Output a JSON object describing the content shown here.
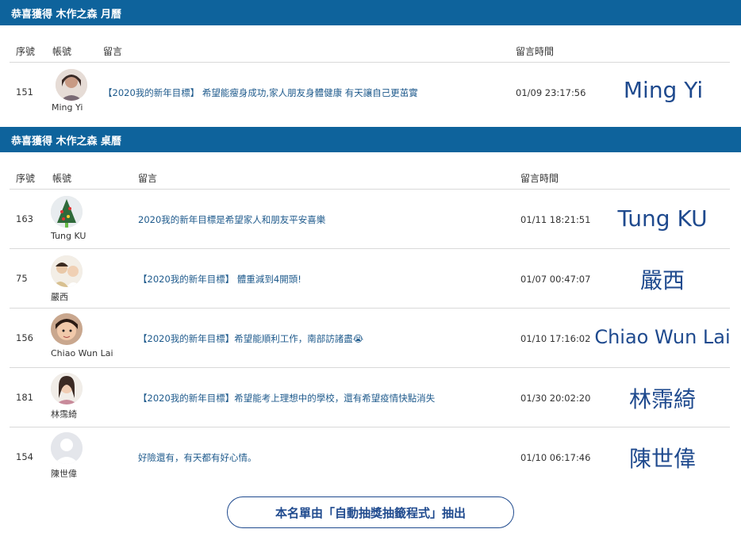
{
  "monthly": {
    "title": "恭喜獲得 木作之森 月曆",
    "headers": {
      "seq": "序號",
      "account": "帳號",
      "message": "留言",
      "time": "留言時間"
    },
    "rows": [
      {
        "seq": "151",
        "user": "Ming Yi",
        "message": "【2020我的新年目標】 希望能瘦身成功,家人朋友身體健康 有天讓自己更茁實",
        "time": "01/09 23:17:56",
        "winner": "Ming Yi"
      }
    ]
  },
  "desk": {
    "title": "恭喜獲得 木作之森 桌曆",
    "headers": {
      "seq": "序號",
      "account": "帳號",
      "message": "留言",
      "time": "留言時間"
    },
    "rows": [
      {
        "seq": "163",
        "user": "Tung KU",
        "message": "2020我的新年目標是希望家人和朋友平安喜樂",
        "time": "01/11 18:21:51",
        "winner": "Tung KU"
      },
      {
        "seq": "75",
        "user": "嚴西",
        "message": "【2020我的新年目標】 體重減到4開頭!",
        "time": "01/07 00:47:07",
        "winner": "嚴西"
      },
      {
        "seq": "156",
        "user": "Chiao Wun Lai",
        "message": "【2020我的新年目標】希望能順利工作，南部訪諸盡😭",
        "time": "01/10 17:16:02",
        "winner": "Chiao Wun Lai"
      },
      {
        "seq": "181",
        "user": "林霈綺",
        "message": "【2020我的新年目標】希望能考上理想中的學校，還有希望疫情快點消失",
        "time": "01/30 20:02:20",
        "winner": "林霈綺"
      },
      {
        "seq": "154",
        "user": "陳世偉",
        "message": "好險還有，有天都有好心情。",
        "time": "01/10 06:17:46",
        "winner": "陳世偉"
      }
    ]
  },
  "footer": {
    "label": "本名單由「自動抽獎抽籤程式」抽出"
  },
  "colors": {
    "header_bg": "#0e639c",
    "winner_text": "#1f4a8e",
    "message_text": "#1e5a8c"
  }
}
